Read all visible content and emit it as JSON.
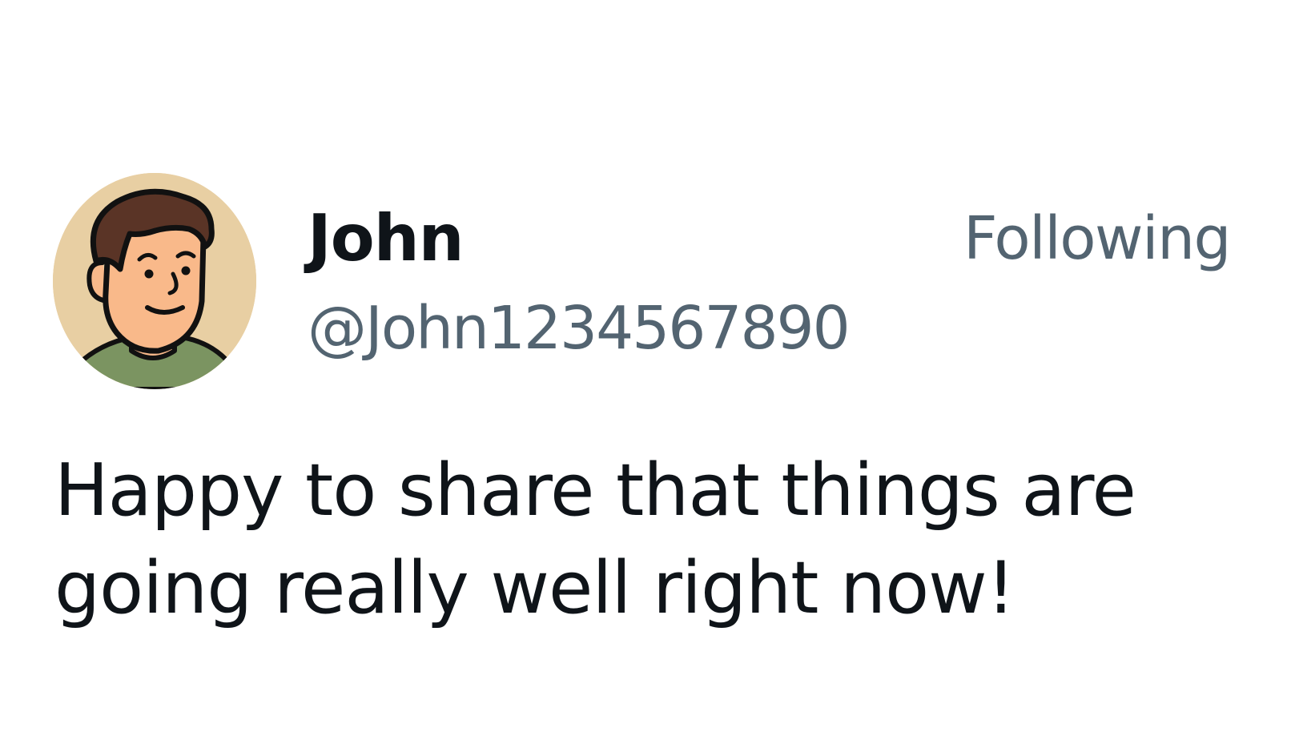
{
  "post": {
    "author": {
      "display_name": "John",
      "handle": "@John1234567890",
      "avatar": "cartoon-man-avatar"
    },
    "follow_status": "Following",
    "text": "Happy to share that things are going really well right now!"
  },
  "colors": {
    "text_primary": "#0f1419",
    "text_secondary": "#536471",
    "avatar_bg": "#e8cfa3",
    "skin": "#f9b98a",
    "hair": "#5a3426",
    "shirt": "#7b9461"
  }
}
